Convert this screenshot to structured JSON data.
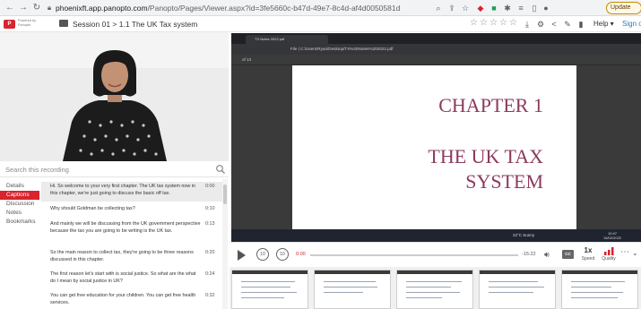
{
  "browser": {
    "url_host": "phoenixft.app.panopto.com",
    "url_path": "/Panopto/Pages/Viewer.aspx?id=3fe5660c-b47d-49e7-8c4d-af4d0050581d",
    "update_label": "Update",
    "icons": [
      "back-icon",
      "forward-icon",
      "reload-icon",
      "lock-icon",
      "zoom-icon",
      "share-icon",
      "bookmark-star-icon",
      "extension-icon",
      "puzzle-icon",
      "menu-icon"
    ]
  },
  "header": {
    "logo_letter": "P",
    "powered_by_line1": "Powered by",
    "powered_by_line2": "Panopto",
    "breadcrumb": "Session 01  >  1.1 The UK Tax system",
    "help_label": "Help ▾",
    "signin_label": "Sign ou"
  },
  "search": {
    "placeholder": "Search this recording"
  },
  "tabs": [
    "Details",
    "Captions",
    "Discussion",
    "Notes",
    "Bookmarks"
  ],
  "active_tab": 1,
  "captions": [
    {
      "text": "Hi. So welcome to your very first chapter. The UK tax system now in this chapter, we're just going to discuss the basic off tax.",
      "time": "0:00"
    },
    {
      "text": "Why should Goldman be collecting tax?",
      "time": "0:10"
    },
    {
      "text": "And mainly we will be discussing from the UK government perspective because the tax you are going to be writing is the UK tax.",
      "time": "0:13"
    },
    {
      "text": "So the main reason to collect tax, they're going to be three reasons discussed in this chapter.",
      "time": "0:20"
    },
    {
      "text": "The first reason let's start with is social justice. So what are the what do I mean by social justice in UK?",
      "time": "0:24"
    },
    {
      "text": "You can get free education for your children. You can get free health services.",
      "time": "0:32"
    }
  ],
  "screen": {
    "pdf_tab_title": "TX Notes 2022.pdf",
    "pdf_url": "File  |  C:/Users/Ryan/Desktop/TX%20Notes%202022.pdf",
    "page_indicator": "of 13",
    "chapter_title": "CHAPTER 1",
    "chapter_sub1": "THE UK TAX",
    "chapter_sub2": "SYSTEM",
    "weather": "22°C  Sunny",
    "clock_time": "10:47",
    "clock_date": "15/02/2022"
  },
  "player": {
    "current_time": "0:00",
    "remaining_time": "-15:22",
    "progress": 0.0,
    "cc_label": "CC",
    "speed_value": "1x",
    "speed_label": "Speed",
    "quality_label": "Quality"
  },
  "colors": {
    "accent": "#d9232d",
    "chapter": "#8b3a5e"
  }
}
